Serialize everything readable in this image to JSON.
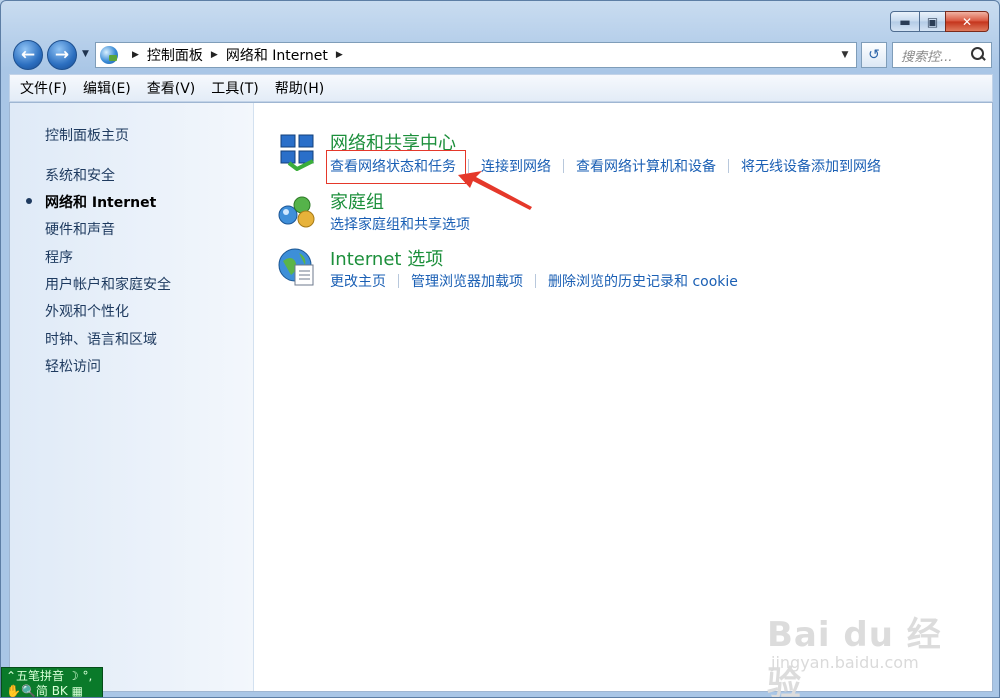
{
  "window": {
    "min_glyph": "▬",
    "max_glyph": "▣",
    "close_glyph": "✕"
  },
  "nav": {
    "back_glyph": "←",
    "forward_glyph": "→",
    "dropdown_glyph": "▼",
    "address_dropdown_glyph": "▼",
    "refresh_glyph": "↺",
    "breadcrumb": [
      "控制面板",
      "网络和 Internet"
    ],
    "search_placeholder": "搜索控..."
  },
  "menubar": {
    "items": [
      "文件(F)",
      "编辑(E)",
      "查看(V)",
      "工具(T)",
      "帮助(H)"
    ]
  },
  "sidebar": {
    "home": "控制面板主页",
    "items": [
      {
        "label": "系统和安全",
        "active": false
      },
      {
        "label": "网络和 Internet",
        "active": true
      },
      {
        "label": "硬件和声音",
        "active": false
      },
      {
        "label": "程序",
        "active": false
      },
      {
        "label": "用户帐户和家庭安全",
        "active": false
      },
      {
        "label": "外观和个性化",
        "active": false
      },
      {
        "label": "时钟、语言和区域",
        "active": false
      },
      {
        "label": "轻松访问",
        "active": false
      }
    ]
  },
  "categories": [
    {
      "title": "网络和共享中心",
      "icon": "network-sharing-icon",
      "links": [
        "查看网络状态和任务",
        "连接到网络",
        "查看网络计算机和设备",
        "将无线设备添加到网络"
      ]
    },
    {
      "title": "家庭组",
      "icon": "homegroup-icon",
      "links": [
        "选择家庭组和共享选项"
      ]
    },
    {
      "title": "Internet 选项",
      "icon": "internet-options-icon",
      "links": [
        "更改主页",
        "管理浏览器加载项",
        "删除浏览的历史记录和 cookie"
      ]
    }
  ],
  "ime": {
    "line1": "⌃五笔拼音 ☽ °,",
    "line2": "✋🔍简 BK ▦"
  },
  "watermark": {
    "brand": "Bai du 经验",
    "url": "jingyan.baidu.com"
  },
  "colors": {
    "category_title": "#1c8f3b",
    "link": "#1a5fb4",
    "annotation": "#e5382a"
  }
}
